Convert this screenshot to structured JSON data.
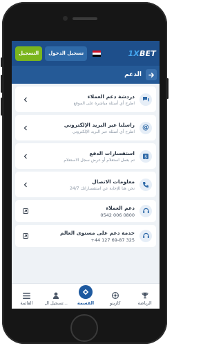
{
  "header": {
    "register_label": "التسجيل",
    "login_label": "تسجيل الدخول",
    "logo_prefix": "1X",
    "logo_suffix": "BET",
    "flag_colors": [
      "#ce1126",
      "#ffffff",
      "#000000"
    ]
  },
  "section": {
    "title": "الدعم"
  },
  "items": [
    {
      "title": "دردشة دعم العملاء",
      "subtitle": "اطرح أي أسئلة مباشرة على الموقع",
      "icon": "chat-icon"
    },
    {
      "title": "راسلنا عبر البريد الإلكتروني",
      "subtitle": "اطرح أي أسئلة عبر البريد الإلكتروني",
      "icon": "at-sign-icon"
    },
    {
      "title": "استفسارات الدفع",
      "subtitle": "تم بعمل استعلام أو عرض سجل الاستعلام",
      "icon": "payment-icon"
    },
    {
      "title": "معلومات الاتصال",
      "subtitle": "نحن هنا للإجابة عن استفساراتك 24/7",
      "icon": "phone-icon"
    },
    {
      "title": "دعم العملاء",
      "subtitle": "0542 006 0800",
      "icon": "headset-icon"
    },
    {
      "title": "خدمة دعم على مستوى العالم",
      "subtitle": "+44 127 69-87 325",
      "icon": "headset-icon"
    }
  ],
  "nav": {
    "sports": "الرياضة",
    "casino": "كازينو",
    "menu_center": "القسمة",
    "register": "تسجيل ال...",
    "list": "القائمة"
  },
  "colors": {
    "header_bg": "#1e4f8b",
    "register_green": "#7ab51d",
    "accent_blue": "#1e5aa0"
  }
}
